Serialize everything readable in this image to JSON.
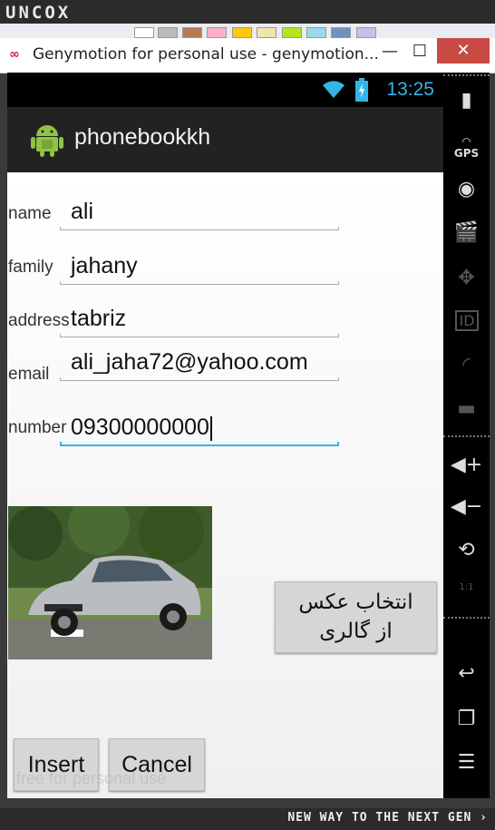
{
  "app_bar": {
    "brand": "UNCOX"
  },
  "ribbon": {
    "swatch_colors": [
      "#ffffff",
      "#b9b9b9",
      "#b97a57",
      "#ffaec9",
      "#ffc90e",
      "#efe4b0",
      "#b5e61d",
      "#99d9ea",
      "#7092be",
      "#c8bfe7"
    ]
  },
  "window": {
    "title": "Genymotion for personal use - genymotion...",
    "minimize_icon": "minimize-icon",
    "maximize_icon": "maximize-icon",
    "close_label": "✕"
  },
  "statusbar": {
    "time": "13:25",
    "accent": "#33b5e5",
    "battery_icon": "battery-charging-icon",
    "wifi_icon": "wifi-icon"
  },
  "actionbar": {
    "title": "phonebookkh",
    "icon": "android-icon"
  },
  "form": {
    "fields": [
      {
        "label": "name",
        "value": "ali"
      },
      {
        "label": "family",
        "value": "jahany"
      },
      {
        "label": "address",
        "value": "tabriz"
      },
      {
        "label": "email",
        "value": "ali_jaha72@yahoo.com"
      },
      {
        "label": "number",
        "value": "09300000000"
      }
    ]
  },
  "gallery_button": {
    "line1": "انتخاب عکس",
    "line2": "از گالری"
  },
  "buttons": {
    "insert": "Insert",
    "cancel": "Cancel"
  },
  "watermark": "free for personal use",
  "sidebar": {
    "icons": [
      "battery-icon",
      "gps-icon",
      "webcam-icon",
      "media-icon",
      "dpad-icon",
      "id-icon",
      "cast-icon",
      "sms-icon",
      "volume-up-icon",
      "volume-down-icon",
      "rotate-icon",
      "pixel-perfect-icon",
      "back-icon",
      "recent-apps-icon",
      "menu-icon"
    ],
    "gps_label": "GPS",
    "id_label": "ID",
    "ratio_label": "1:1"
  },
  "bottom_bar": {
    "tagline": "NEW WAY TO THE NEXT GEN ›"
  }
}
